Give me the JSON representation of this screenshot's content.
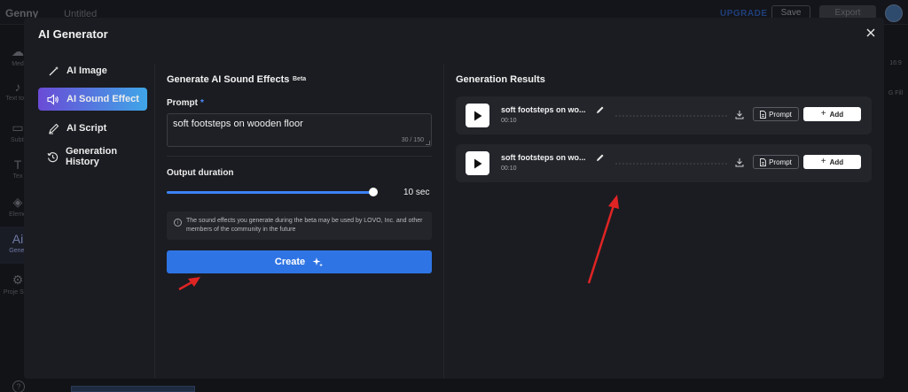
{
  "background_app": {
    "logo": "Genny",
    "doc_title": "Untitled",
    "upgrade": "UPGRADE",
    "save": "Save",
    "export": "Export",
    "left_nav": [
      {
        "icon": "media-icon",
        "glyph": "☁",
        "label": "Med"
      },
      {
        "icon": "text-to-speech-icon",
        "glyph": "♪",
        "label": "Text to S"
      },
      {
        "icon": "subtitles-icon",
        "glyph": "▭",
        "label": "Subti"
      },
      {
        "icon": "text-icon",
        "glyph": "T",
        "label": "Tex"
      },
      {
        "icon": "elements-icon",
        "glyph": "◈",
        "label": "Eleme"
      },
      {
        "icon": "ai-generator-icon",
        "glyph": "Ai",
        "label": "Gener"
      },
      {
        "icon": "project-settings-icon",
        "glyph": "⚙",
        "label": "Proje Setti"
      }
    ],
    "right_labels": [
      "16:9",
      "G Fill"
    ]
  },
  "modal": {
    "title": "AI Generator",
    "menu": [
      {
        "label": "AI Image",
        "icon": "magic-wand-icon",
        "active": false
      },
      {
        "label": "AI Sound Effect",
        "icon": "speaker-icon",
        "active": true
      },
      {
        "label": "AI Script",
        "icon": "pen-icon",
        "active": false
      },
      {
        "label": "Generation History",
        "icon": "history-icon",
        "active": false
      }
    ],
    "generator": {
      "title": "Generate AI Sound Effects",
      "badge": "Beta",
      "prompt_label": "Prompt",
      "required_mark": "*",
      "prompt_value": "soft footsteps on wooden floor",
      "char_count": "30 / 150",
      "duration_label": "Output duration",
      "duration_value": "10 sec",
      "duration_fraction": 1.0,
      "notice": "The sound effects you generate during the beta may be used by LOVO, Inc. and other members of the community in the future",
      "create_label": "Create"
    },
    "results": {
      "title": "Generation Results",
      "items": [
        {
          "name": "soft footsteps on wo...",
          "duration": "00:10",
          "prompt_label": "Prompt",
          "add_label": "Add"
        },
        {
          "name": "soft footsteps on wo...",
          "duration": "00:10",
          "prompt_label": "Prompt",
          "add_label": "Add"
        }
      ]
    }
  },
  "colors": {
    "accent_blue": "#2f74e4",
    "active_gradient_start": "#6a4bd6",
    "active_gradient_end": "#3fa6e8",
    "annotation_arrow": "#e02424"
  }
}
